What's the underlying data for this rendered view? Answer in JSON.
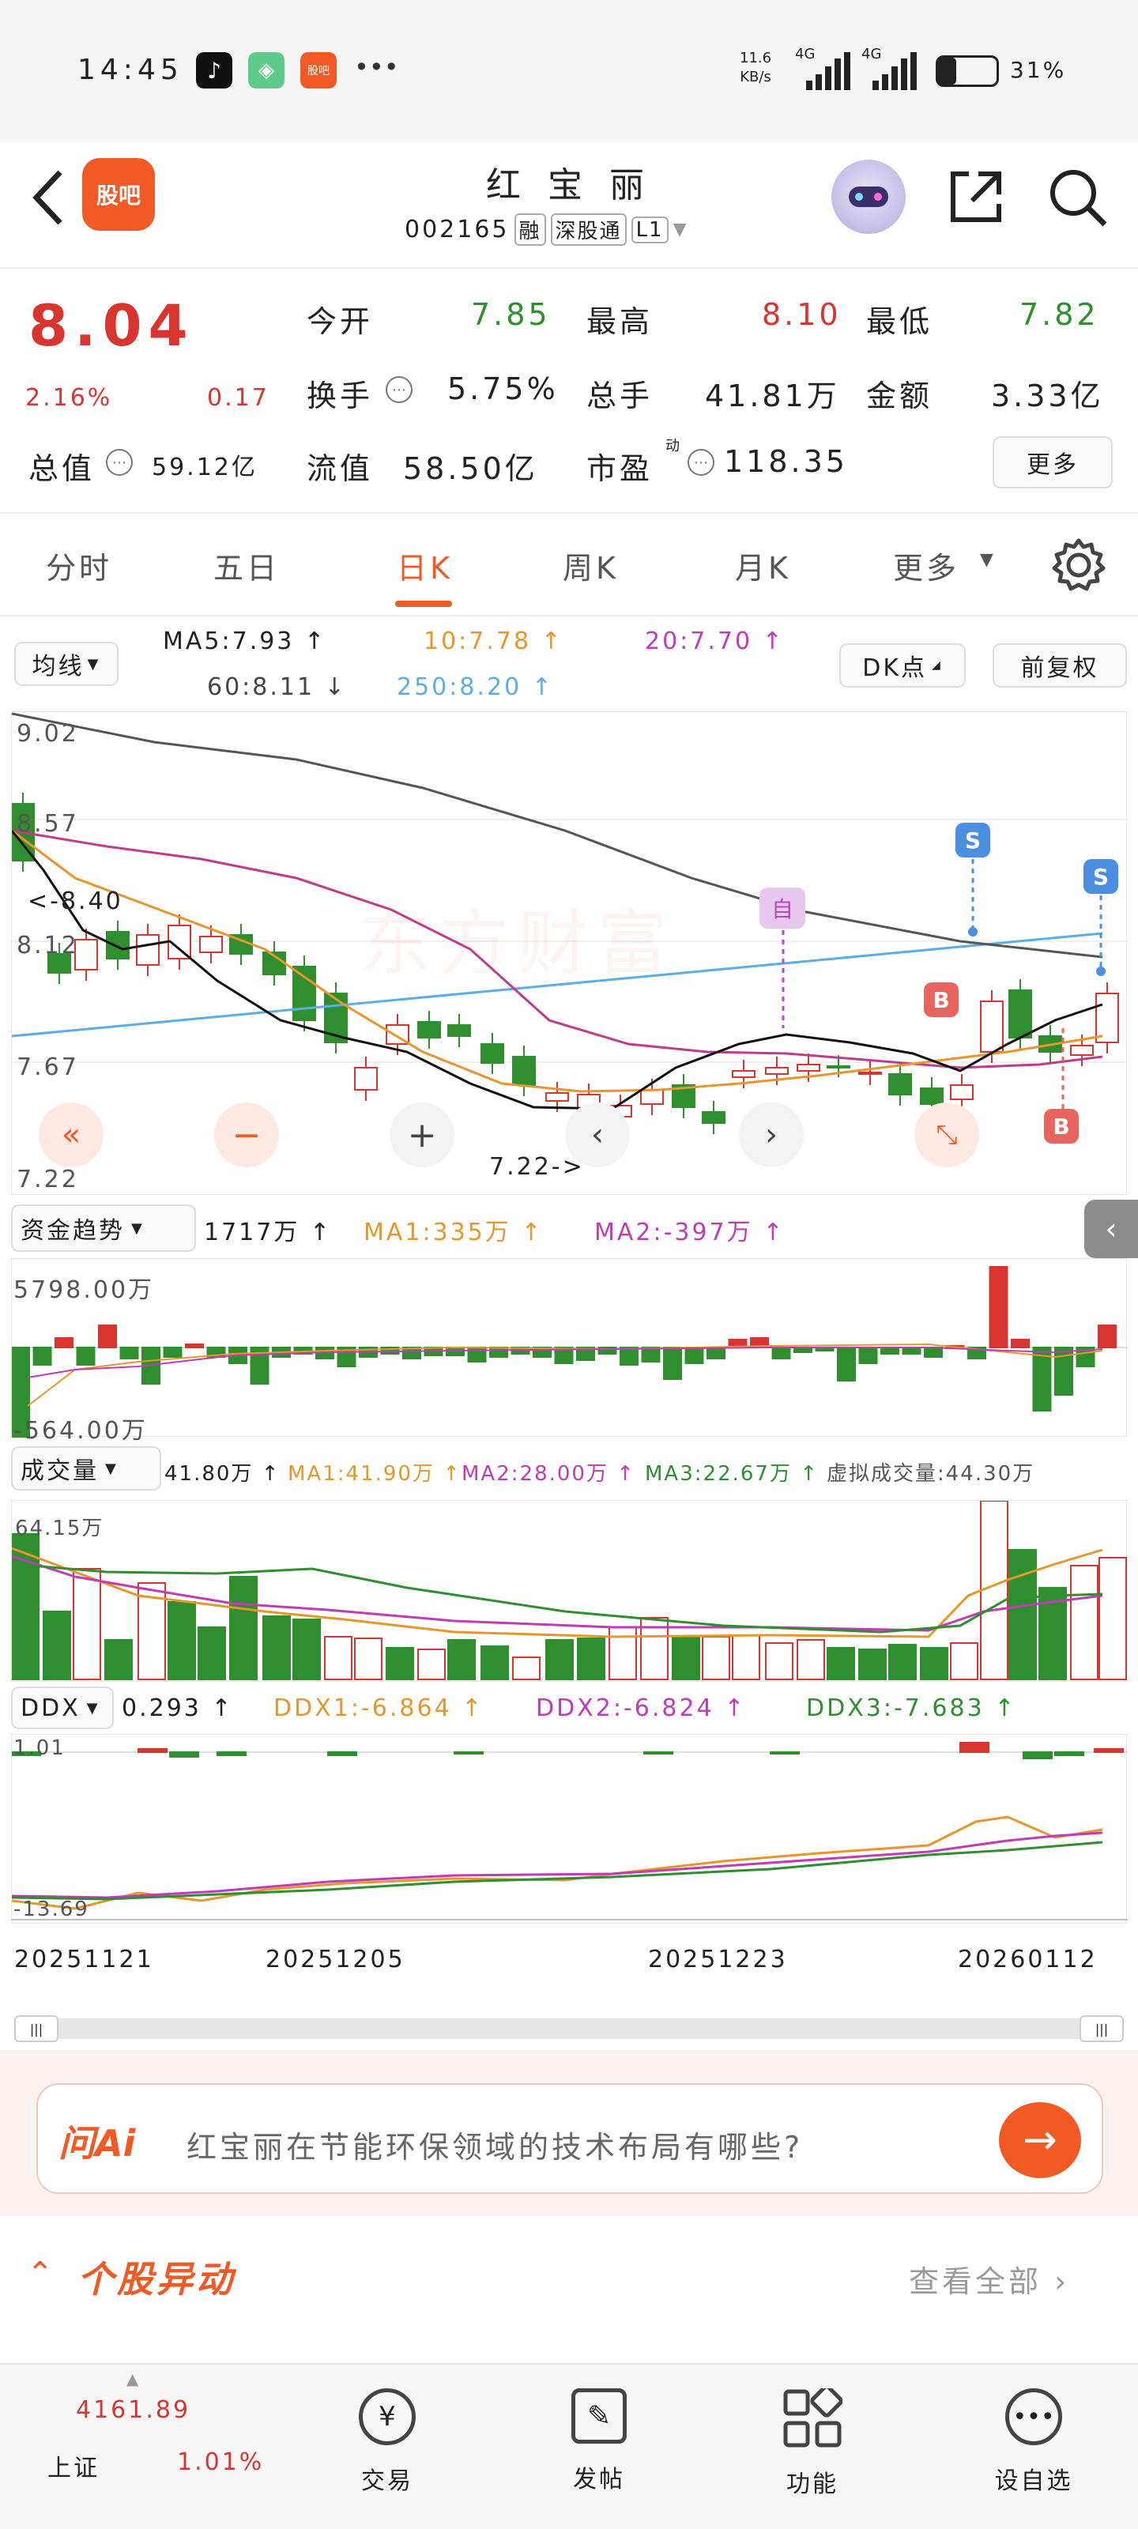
{
  "status": {
    "time": "14:45",
    "speed_value": "11.6",
    "speed_unit": "KB/s",
    "net1": "4G",
    "net2": "4G",
    "battery_pct": "31%",
    "battery_level": 0.31,
    "app_badge": "股吧"
  },
  "header": {
    "logo_label": "股吧",
    "stock_name": "红 宝 丽",
    "stock_code": "002165",
    "tags": [
      "融",
      "深股通",
      "L1"
    ]
  },
  "quote": {
    "price": "8.04",
    "change_pct": "2.16%",
    "change_val": "0.17",
    "open_label": "今开",
    "open": "7.85",
    "high_label": "最高",
    "high": "8.10",
    "low_label": "最低",
    "low": "7.82",
    "turnover_label": "换手",
    "turnover": "5.75%",
    "volume_label": "总手",
    "volume": "41.81万",
    "amount_label": "金额",
    "amount": "3.33亿",
    "mktcap_label": "总值",
    "mktcap": "59.12亿",
    "float_label": "流值",
    "float_cap": "58.50亿",
    "pe_label": "市盈",
    "pe_sup": "动",
    "pe": "118.35",
    "more_label": "更多"
  },
  "tabs": {
    "items": [
      "分时",
      "五日",
      "日K",
      "周K",
      "月K",
      "更多"
    ],
    "active_index": 2
  },
  "ma_bar": {
    "selector": "均线",
    "ma5": "MA5:7.93",
    "ma10": "10:7.78",
    "ma20": "20:7.70",
    "ma60": "60:8.11",
    "ma250": "250:8.20",
    "dk_label": "DK点",
    "adjust_label": "前复权"
  },
  "kline": {
    "axis_top": "9.02",
    "axis_mid1": "8.57",
    "axis_mid2": "8.12",
    "axis_mid3": "7.67",
    "axis_bottom": "7.22",
    "low_marker": "7.22->",
    "prev_marker": "<-8.40",
    "self_label": "自",
    "sell_label": "S",
    "buy_label": "B",
    "watermark": "东方财富"
  },
  "fund": {
    "selector": "资金趋势",
    "value": "1717万",
    "ma1": "MA1:335万",
    "ma2": "MA2:-397万",
    "top": "5798.00万",
    "bottom": "-564.00万"
  },
  "vol": {
    "selector": "成交量",
    "value": "41.80万",
    "ma1": "MA1:41.90万",
    "ma2": "MA2:28.00万",
    "ma3": "MA3:22.67万",
    "virtual": "虚拟成交量:44.30万",
    "top": "64.15万"
  },
  "ddx": {
    "selector": "DDX",
    "value": "0.293",
    "ddx1": "DDX1:-6.864",
    "ddx2": "DDX2:-6.824",
    "ddx3": "DDX3:-7.683",
    "top": "1.01",
    "bottom": "-13.69"
  },
  "dates": [
    "20251121",
    "20251205",
    "20251223",
    "20260112"
  ],
  "ai": {
    "logo": "问Ai",
    "question": "红宝丽在节能环保领域的技术布局有哪些?"
  },
  "movement": {
    "title": "个股异动",
    "view_all": "查看全部"
  },
  "bottom": {
    "index_value": "4161.89",
    "index_name": "上证",
    "index_pct": "1.01%",
    "trade": "交易",
    "post": "发帖",
    "features": "功能",
    "watchlist": "设自选"
  },
  "colors": {
    "up": "#d9352f",
    "down": "#2f8f2f",
    "brand": "#f15a24"
  }
}
